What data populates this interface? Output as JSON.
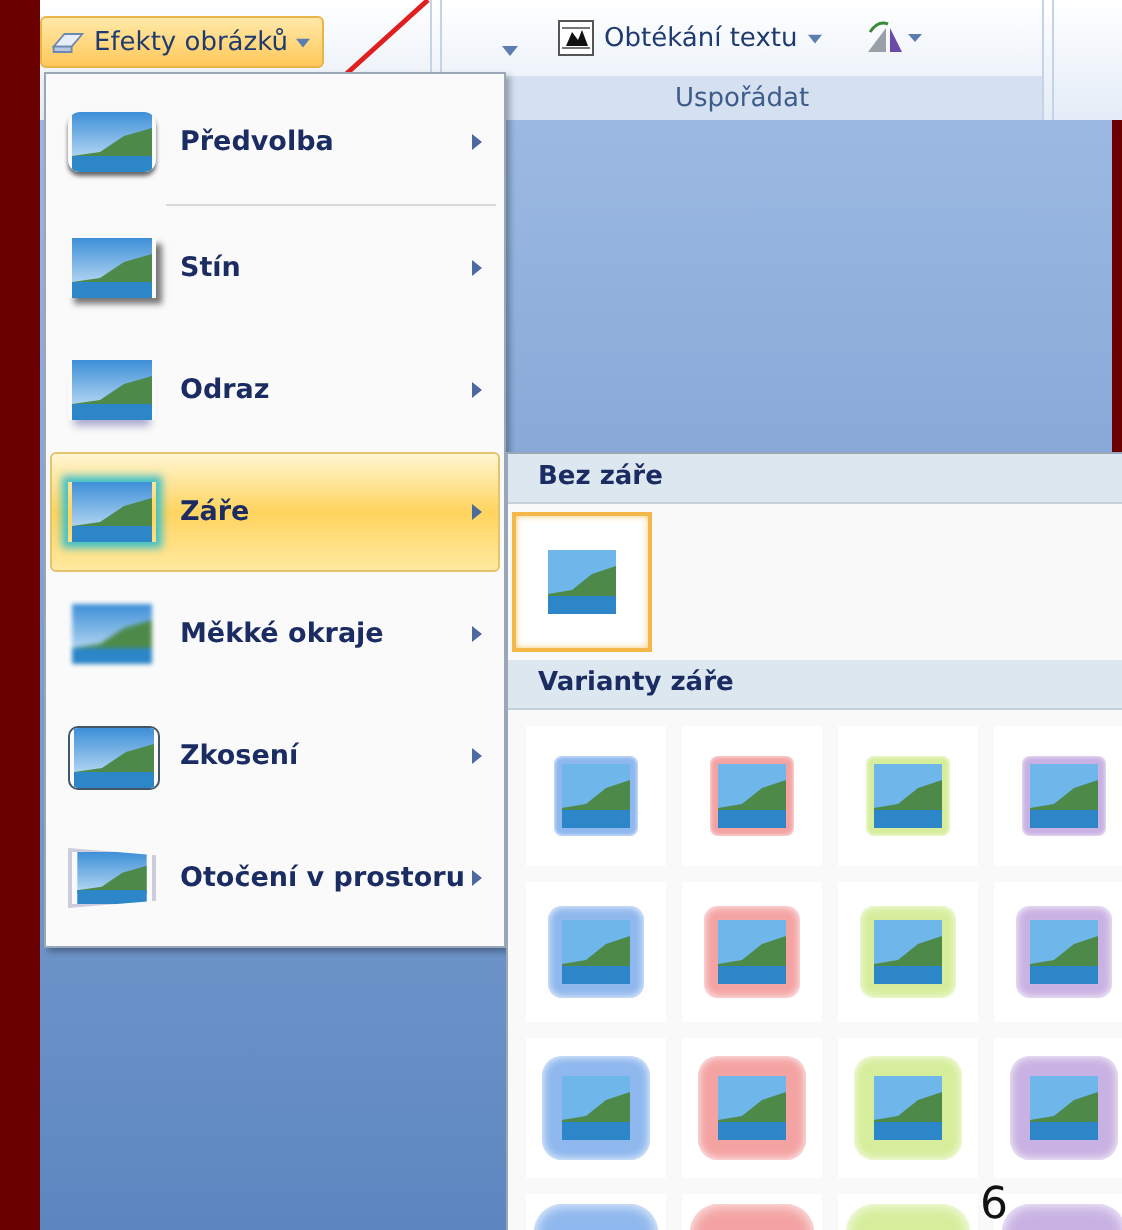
{
  "ribbon": {
    "effects_button": "Efekty obrázků",
    "wrap_button": "Obtékání textu",
    "group_label": "Uspořádat"
  },
  "menu": {
    "items": [
      {
        "label": "Předvolba",
        "selected": false
      },
      {
        "label": "Stín",
        "selected": false
      },
      {
        "label": "Odraz",
        "selected": false
      },
      {
        "label": "Záře",
        "selected": true
      },
      {
        "label": "Měkké okraje",
        "selected": false
      },
      {
        "label": "Zkosení",
        "selected": false
      },
      {
        "label": "Otočení v prostoru",
        "selected": false
      }
    ]
  },
  "submenu": {
    "none_header": "Bez záře",
    "none_option": {
      "selected": true
    },
    "variants_header": "Varianty záře",
    "variant_rows": [
      {
        "kind": "small",
        "items": [
          {
            "color": "#8fb8ee",
            "selected": false
          },
          {
            "color": "#f4a3a3",
            "selected": false
          },
          {
            "color": "#d6ee9c",
            "selected": false
          },
          {
            "color": "#c9b2e3",
            "selected": false
          }
        ]
      },
      {
        "kind": "medium",
        "items": [
          {
            "color": "#8fb8ee",
            "selected": false
          },
          {
            "color": "#f4a3a3",
            "selected": false
          },
          {
            "color": "#d6ee9c",
            "selected": false
          },
          {
            "color": "#c9b2e3",
            "selected": false
          }
        ]
      },
      {
        "kind": "large",
        "items": [
          {
            "color": "#8fb8ee",
            "selected": false
          },
          {
            "color": "#f4a3a3",
            "selected": false
          },
          {
            "color": "#d6ee9c",
            "selected": false
          },
          {
            "color": "#c9b2e3",
            "selected": false
          }
        ]
      },
      {
        "kind": "xlarge",
        "items": [
          {
            "color": "#8fb8ee",
            "selected": false
          },
          {
            "color": "#f4a3a3",
            "selected": false
          },
          {
            "color": "#d6ee9c",
            "selected": false
          },
          {
            "color": "#c9b2e3",
            "selected": false
          }
        ]
      }
    ]
  },
  "slide_number": "6"
}
